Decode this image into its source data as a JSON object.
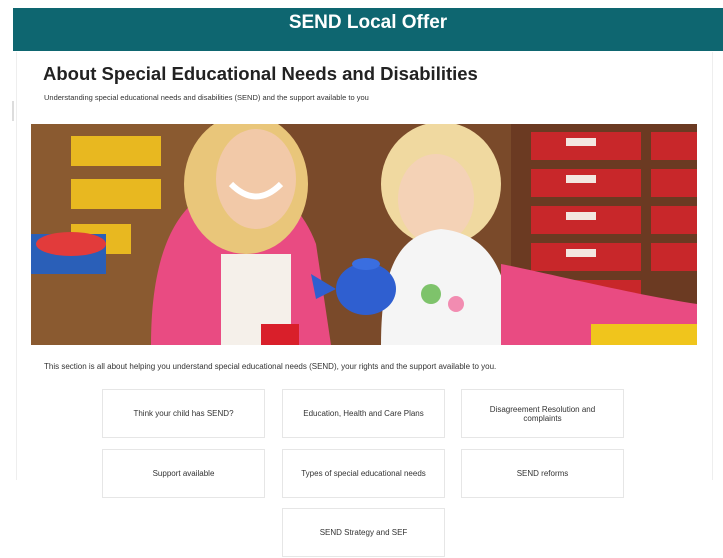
{
  "header": {
    "title": "SEND Local Offer"
  },
  "page": {
    "title": "About Special Educational Needs and Disabilities",
    "subtitle": "Understanding special educational needs and disabilities (SEND) and the support available to you",
    "intro": "This section is all about helping you understand special educational needs (SEND), your rights and the support available to you."
  },
  "hero": {
    "alt": "Woman and young girl playing with a toy teapot in a classroom"
  },
  "cards": [
    {
      "label": "Think your child has SEND?"
    },
    {
      "label": "Education, Health and Care Plans"
    },
    {
      "label": "Disagreement Resolution and complaints"
    },
    {
      "label": "Support available"
    },
    {
      "label": "Types of special educational needs"
    },
    {
      "label": "SEND reforms"
    },
    {
      "label": "SEND Strategy and SEF"
    }
  ],
  "colors": {
    "header_bg": "#0e6670",
    "header_text": "#ffffff",
    "card_border": "#e6e6e6"
  }
}
